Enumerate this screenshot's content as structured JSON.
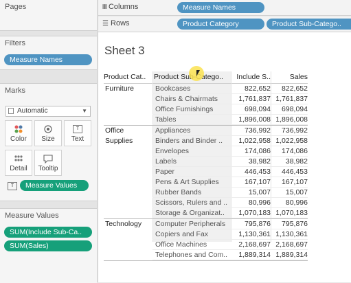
{
  "left_panel": {
    "pages_title": "Pages",
    "filters": {
      "title": "Filters",
      "pills": [
        "Measure Names"
      ]
    },
    "marks": {
      "title": "Marks",
      "type": "Automatic",
      "buttons": [
        "Color",
        "Size",
        "Text",
        "Detail",
        "Tooltip"
      ],
      "text_pill": "Measure Values"
    },
    "measure_values": {
      "title": "Measure Values",
      "pills": [
        "SUM(Include Sub-Ca..",
        "SUM(Sales)"
      ]
    }
  },
  "shelves": {
    "columns": {
      "label": "Columns",
      "pills": [
        "Measure Names"
      ]
    },
    "rows": {
      "label": "Rows",
      "pills": [
        "Product Category",
        "Product Sub-Catego.."
      ]
    }
  },
  "sheet": {
    "title": "Sheet 3",
    "headers": [
      "Product Cat..",
      "Product Sub-Catego..",
      "Include S..",
      "Sales"
    ],
    "groups": [
      {
        "category": "Furniture",
        "rows": [
          {
            "sub": "Bookcases",
            "include": "822,652",
            "sales": "822,652"
          },
          {
            "sub": "Chairs & Chairmats",
            "include": "1,761,837",
            "sales": "1,761,837"
          },
          {
            "sub": "Office Furnishings",
            "include": "698,094",
            "sales": "698,094"
          },
          {
            "sub": "Tables",
            "include": "1,896,008",
            "sales": "1,896,008"
          }
        ]
      },
      {
        "category": "Office\nSupplies",
        "rows": [
          {
            "sub": "Appliances",
            "include": "736,992",
            "sales": "736,992"
          },
          {
            "sub": "Binders and Binder ..",
            "include": "1,022,958",
            "sales": "1,022,958"
          },
          {
            "sub": "Envelopes",
            "include": "174,086",
            "sales": "174,086"
          },
          {
            "sub": "Labels",
            "include": "38,982",
            "sales": "38,982"
          },
          {
            "sub": "Paper",
            "include": "446,453",
            "sales": "446,453"
          },
          {
            "sub": "Pens & Art Supplies",
            "include": "167,107",
            "sales": "167,107"
          },
          {
            "sub": "Rubber Bands",
            "include": "15,007",
            "sales": "15,007"
          },
          {
            "sub": "Scissors, Rulers and ..",
            "include": "80,996",
            "sales": "80,996"
          },
          {
            "sub": "Storage & Organizat..",
            "include": "1,070,183",
            "sales": "1,070,183"
          }
        ]
      },
      {
        "category": "Technology",
        "rows": [
          {
            "sub": "Computer Peripherals",
            "include": "795,876",
            "sales": "795,876"
          },
          {
            "sub": "Copiers and Fax",
            "include": "1,130,361",
            "sales": "1,130,361"
          },
          {
            "sub": "Office Machines",
            "include": "2,168,697",
            "sales": "2,168,697"
          },
          {
            "sub": "Telephones and Com..",
            "include": "1,889,314",
            "sales": "1,889,314"
          }
        ]
      }
    ]
  },
  "colors": {
    "blue_pill": "#4f94c2",
    "green_pill": "#16a07a",
    "cursor_highlight": "#fae250"
  }
}
